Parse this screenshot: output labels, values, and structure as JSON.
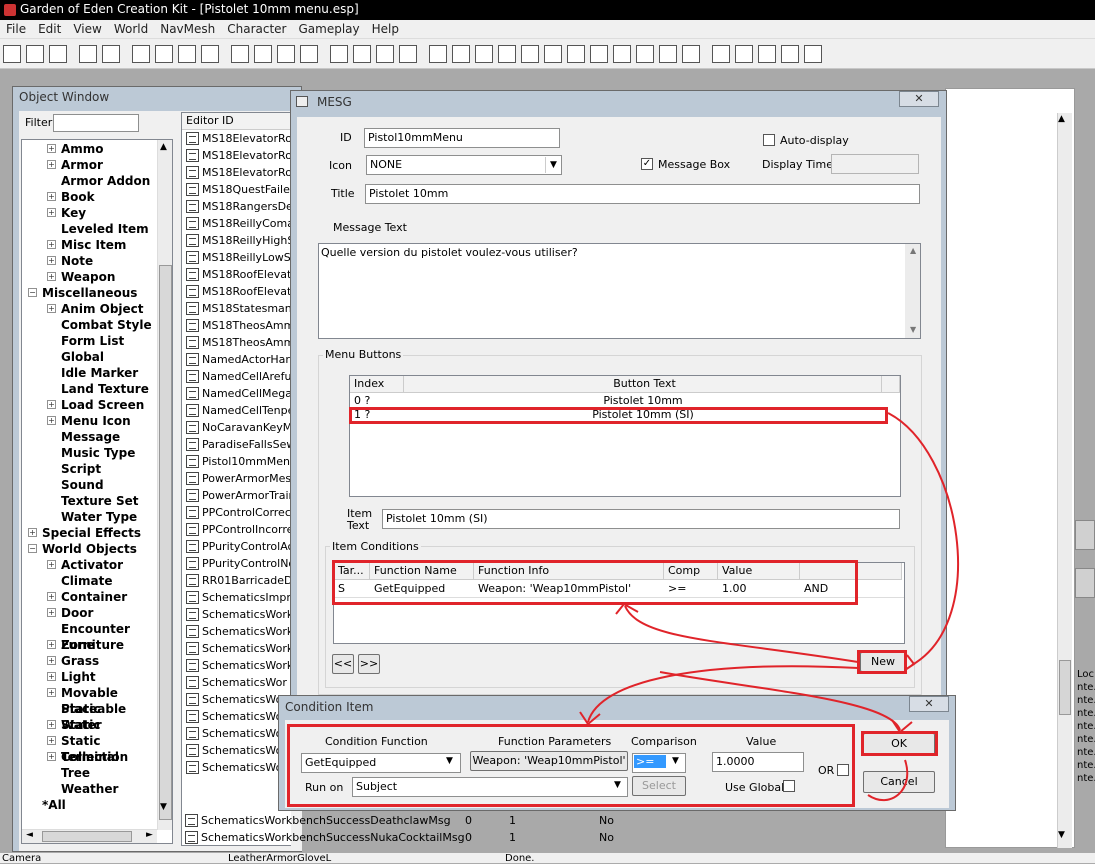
{
  "app": {
    "title": "Garden of Eden Creation Kit - [Pistolet 10mm menu.esp]"
  },
  "menubar": [
    "File",
    "Edit",
    "View",
    "World",
    "NavMesh",
    "Character",
    "Gameplay",
    "Help"
  ],
  "toolbar_icons": [
    "open",
    "save",
    "preferences",
    "undo",
    "redo",
    "grid",
    "snap",
    "angle",
    "cell",
    "landscape",
    "hdr",
    "light",
    "sky",
    "leaf",
    "lasso",
    "brush",
    "terrain",
    "box1",
    "box2",
    "box3",
    "box4",
    "box5",
    "box6",
    "box7",
    "box8",
    "box9",
    "box10",
    "box11",
    "box12",
    "move",
    "rotate",
    "c-button",
    "box13",
    "settings"
  ],
  "objwin": {
    "title": "Object Window",
    "filter_label": "Filter",
    "filter_value": "",
    "list_header": "Editor ID",
    "tree": [
      {
        "label": "Ammo",
        "indent": 2,
        "exp": "+"
      },
      {
        "label": "Armor",
        "indent": 2,
        "exp": "+"
      },
      {
        "label": "Armor Addon",
        "indent": 2,
        "exp": ""
      },
      {
        "label": "Book",
        "indent": 2,
        "exp": "+"
      },
      {
        "label": "Key",
        "indent": 2,
        "exp": "+"
      },
      {
        "label": "Leveled Item",
        "indent": 2,
        "exp": ""
      },
      {
        "label": "Misc Item",
        "indent": 2,
        "exp": "+"
      },
      {
        "label": "Note",
        "indent": 2,
        "exp": "+"
      },
      {
        "label": "Weapon",
        "indent": 2,
        "exp": "+"
      },
      {
        "label": "Miscellaneous",
        "indent": 1,
        "exp": "-"
      },
      {
        "label": "Anim Object",
        "indent": 2,
        "exp": "+"
      },
      {
        "label": "Combat Style",
        "indent": 2,
        "exp": ""
      },
      {
        "label": "Form List",
        "indent": 2,
        "exp": ""
      },
      {
        "label": "Global",
        "indent": 2,
        "exp": ""
      },
      {
        "label": "Idle Marker",
        "indent": 2,
        "exp": ""
      },
      {
        "label": "Land Texture",
        "indent": 2,
        "exp": ""
      },
      {
        "label": "Load Screen",
        "indent": 2,
        "exp": "+"
      },
      {
        "label": "Menu Icon",
        "indent": 2,
        "exp": "+"
      },
      {
        "label": "Message",
        "indent": 2,
        "exp": ""
      },
      {
        "label": "Music Type",
        "indent": 2,
        "exp": ""
      },
      {
        "label": "Script",
        "indent": 2,
        "exp": ""
      },
      {
        "label": "Sound",
        "indent": 2,
        "exp": ""
      },
      {
        "label": "Texture Set",
        "indent": 2,
        "exp": ""
      },
      {
        "label": "Water Type",
        "indent": 2,
        "exp": ""
      },
      {
        "label": "Special Effects",
        "indent": 1,
        "exp": "+"
      },
      {
        "label": "World Objects",
        "indent": 1,
        "exp": "-"
      },
      {
        "label": "Activator",
        "indent": 2,
        "exp": "+"
      },
      {
        "label": "Climate",
        "indent": 2,
        "exp": ""
      },
      {
        "label": "Container",
        "indent": 2,
        "exp": "+"
      },
      {
        "label": "Door",
        "indent": 2,
        "exp": "+"
      },
      {
        "label": "Encounter Zone",
        "indent": 2,
        "exp": ""
      },
      {
        "label": "Furniture",
        "indent": 2,
        "exp": "+"
      },
      {
        "label": "Grass",
        "indent": 2,
        "exp": "+"
      },
      {
        "label": "Light",
        "indent": 2,
        "exp": "+"
      },
      {
        "label": "Movable Static",
        "indent": 2,
        "exp": "+"
      },
      {
        "label": "Placeable Water",
        "indent": 2,
        "exp": ""
      },
      {
        "label": "Static",
        "indent": 2,
        "exp": "+"
      },
      {
        "label": "Static Collection",
        "indent": 2,
        "exp": "+"
      },
      {
        "label": "Terminal",
        "indent": 2,
        "exp": "+"
      },
      {
        "label": "Tree",
        "indent": 2,
        "exp": ""
      },
      {
        "label": "Weather",
        "indent": 2,
        "exp": ""
      },
      {
        "label": "*All",
        "indent": 1,
        "exp": ""
      }
    ],
    "list": [
      "MS18ElevatorRoo",
      "MS18ElevatorRoo",
      "MS18ElevatorRoo",
      "MS18QuestFailedI",
      "MS18RangersDea",
      "MS18ReillyComaM",
      "MS18ReillyHighSk",
      "MS18ReillyLowSk",
      "MS18RoofElevato",
      "MS18RoofElevato",
      "MS18StatesmanR",
      "MS18TheosAmmo",
      "MS18TheosAmmo",
      "NamedActorHarol",
      "NamedCellArefu",
      "NamedCellMegato",
      "NamedCellTenper",
      "NoCaravanKeyMs",
      "ParadiseFallsSewe",
      "Pistol10mmMenu",
      "PowerArmorMessa",
      "PowerArmorTrainin",
      "PPControlCorrectC",
      "PPControlIncorrec",
      "PPurityControlActi",
      "PPurityControlNoF",
      "RR01BarricadeDo",
      "SchematicsImprov",
      "SchematicsWorkb",
      "SchematicsWorkb",
      "SchematicsWorkb",
      "SchematicsWorkb",
      "SchematicsWor",
      "SchematicsWor",
      "SchematicsWor",
      "SchematicsWor",
      "SchematicsWor",
      "SchematicsWor"
    ],
    "bottom_rows": [
      {
        "id": "SchematicsWorkbenchSuccessDeathclawMsg",
        "a": "0",
        "b": "1",
        "c": "No"
      },
      {
        "id": "SchematicsWorkbenchSuccessNukaCocktailMsg",
        "a": "0",
        "b": "1",
        "c": "No"
      }
    ],
    "right_edge": [
      "Loc.",
      "nte.",
      "nte.",
      "nte.",
      "nte.",
      "nte.",
      "nte.",
      "nte.",
      "nte."
    ]
  },
  "status": {
    "left": "Camera",
    "mid": "LeatherArmorGloveL",
    "right": "Done."
  },
  "mesg": {
    "title": "MESG",
    "close": "✕",
    "id_label": "ID",
    "id_value": "Pistol10mmMenu",
    "icon_label": "Icon",
    "icon_value": "NONE",
    "title_label": "Title",
    "title_value": "Pistolet 10mm",
    "autodisplay_label": "Auto-display",
    "messagebox_label": "Message Box",
    "displaytime_label": "Display Time",
    "messagebox_checked": "✓",
    "message_text_label": "Message Text",
    "message_text": "Quelle version du pistolet voulez-vous utiliser?",
    "menu_buttons_label": "Menu Buttons",
    "btn_headers": {
      "index": "Index",
      "text": "Button Text"
    },
    "buttons": [
      {
        "index": "0 ?",
        "text": "Pistolet 10mm"
      },
      {
        "index": "1 ?",
        "text": "Pistolet 10mm (SI)"
      }
    ],
    "item_text_label": "Item\nText",
    "item_text_value": "Pistolet 10mm (SI)",
    "item_conditions_label": "Item Conditions",
    "cond_headers": [
      "Tar...",
      "Function Name",
      "Function Info",
      "Comp",
      "Value",
      ""
    ],
    "cond_rows": [
      [
        "S",
        "GetEquipped",
        "Weapon: 'Weap10mmPistol'",
        ">=",
        "1.00",
        "AND"
      ]
    ],
    "prev_btn": "<<",
    "next_btn": ">>",
    "new_btn": "New"
  },
  "cond": {
    "title": "Condition Item",
    "close": "✕",
    "func_label": "Condition Function",
    "func_value": "GetEquipped",
    "params_label": "Function Parameters",
    "params_value": "Weapon: 'Weap10mmPistol'",
    "comp_label": "Comparison",
    "comp_value": ">=",
    "value_label": "Value",
    "value_value": "1.0000",
    "runon_label": "Run on",
    "runon_value": "Subject",
    "select_btn": "Select",
    "useglobal_label": "Use Global",
    "or_label": "OR",
    "ok_btn": "OK",
    "cancel_btn": "Cancel"
  },
  "annotation_color": "#e0242a"
}
